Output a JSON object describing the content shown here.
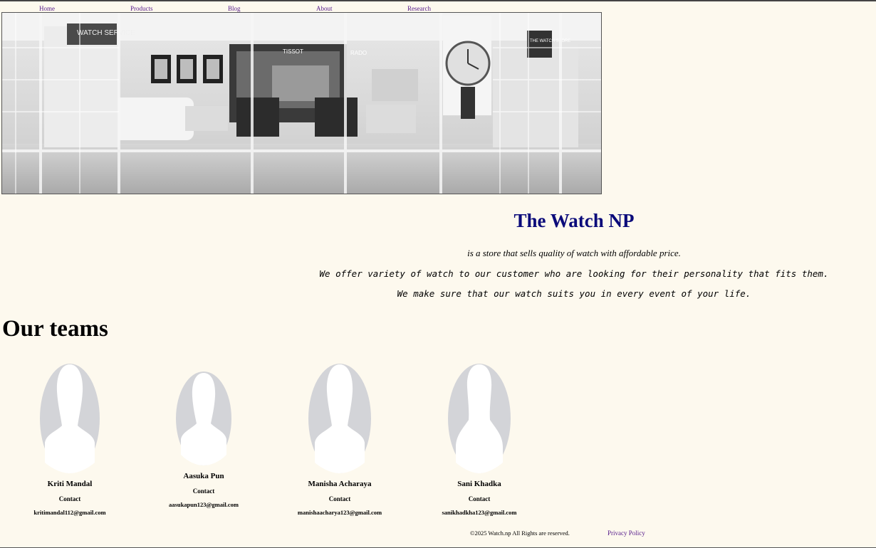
{
  "nav": {
    "items": [
      "Home",
      "Products",
      "Blog",
      "About",
      "Research"
    ]
  },
  "hero": {
    "signs": [
      "WATCH SERVICE",
      "TISSOT",
      "RADO",
      "THE WATCH STORE"
    ]
  },
  "brand": {
    "title": "The Watch NP",
    "tagline_1": "is a store that sells quality of watch with affordable price.",
    "tagline_2": "We offer variety of watch to our customer who are looking for their personality that fits them.",
    "tagline_3": "We make sure that our watch suits you in every event of your life."
  },
  "team": {
    "heading": "Our teams",
    "members": [
      {
        "name": "Kriti Mandal",
        "contact_label": "Contact",
        "email": "kritimandal112@gmail.com"
      },
      {
        "name": "Aasuka Pun",
        "contact_label": "Contact",
        "email": "aasukapun123@gmail.com"
      },
      {
        "name": "Manisha Acharaya",
        "contact_label": "Contact",
        "email": "manishaacharya123@gmail.com"
      },
      {
        "name": "Sani Khadka",
        "contact_label": "Contact",
        "email": "sanikhadkha123@gmail.com"
      }
    ]
  },
  "footer": {
    "copyright": "©2025 Watch.np All Rights are reserved.",
    "privacy": "Privacy Policy"
  },
  "colors": {
    "background": "#fdf9ee",
    "title": "#0b0b7a",
    "link": "#551a8b"
  }
}
